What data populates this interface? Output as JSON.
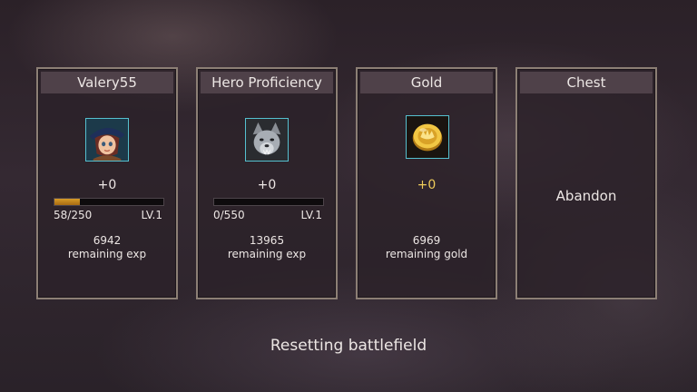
{
  "panels": {
    "player": {
      "title": "Valery55",
      "delta": "+0",
      "progress": {
        "current": 58,
        "max": 250,
        "text": "58/250",
        "level": "LV.1"
      },
      "remaining_value": "6942",
      "remaining_label": "remaining exp",
      "icon": "hero-portrait-icon"
    },
    "proficiency": {
      "title": "Hero Proficiency",
      "delta": "+0",
      "progress": {
        "current": 0,
        "max": 550,
        "text": "0/550",
        "level": "LV.1"
      },
      "remaining_value": "13965",
      "remaining_label": "remaining exp",
      "icon": "werewolf-hero-icon"
    },
    "gold": {
      "title": "Gold",
      "delta": "+0",
      "remaining_value": "6969",
      "remaining_label": "remaining gold",
      "icon": "gold-coin-icon"
    },
    "chest": {
      "title": "Chest",
      "status": "Abandon"
    }
  },
  "footer": {
    "status": "Resetting battlefield"
  },
  "colors": {
    "frame": "#8c7f75",
    "header": "#4f4149",
    "exp_bar": "#d79b27",
    "gold_text": "#eecb5a",
    "icon_border": "#55c0cf"
  }
}
